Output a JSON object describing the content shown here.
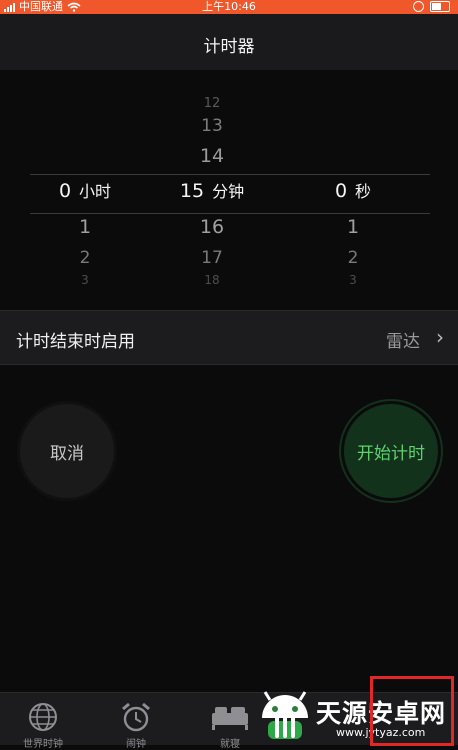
{
  "status_bar": {
    "carrier": "中国联通",
    "time": "上午10:46",
    "icons": [
      "signal-icon",
      "wifi-icon",
      "alarm-icon",
      "battery-icon"
    ]
  },
  "header": {
    "title": "计时器"
  },
  "picker": {
    "hours": {
      "above": [],
      "selected": "0",
      "unit": "小时",
      "below": [
        "1",
        "2",
        "3"
      ]
    },
    "minutes": {
      "above": [
        "12",
        "13",
        "14"
      ],
      "selected": "15",
      "unit": "分钟",
      "below": [
        "16",
        "17",
        "18"
      ]
    },
    "seconds": {
      "above": [],
      "selected": "0",
      "unit": "秒",
      "below": [
        "1",
        "2",
        "3"
      ]
    }
  },
  "end_action": {
    "label": "计时结束时启用",
    "value": "雷达"
  },
  "buttons": {
    "cancel": "取消",
    "start": "开始计时"
  },
  "tabbar": {
    "items": [
      {
        "label": "世界时钟",
        "icon": "globe-icon"
      },
      {
        "label": "闹钟",
        "icon": "alarm-clock-icon"
      },
      {
        "label": "就寝",
        "icon": "bed-icon"
      },
      {
        "label": "",
        "icon": ""
      },
      {
        "label": "",
        "icon": ""
      }
    ]
  },
  "watermark": {
    "name": "天源安卓网",
    "url": "www.jytyaz.com"
  },
  "colors": {
    "accent_green": "#5fd26e",
    "status_bar": "#f0572a",
    "highlight_box": "#e02828"
  }
}
